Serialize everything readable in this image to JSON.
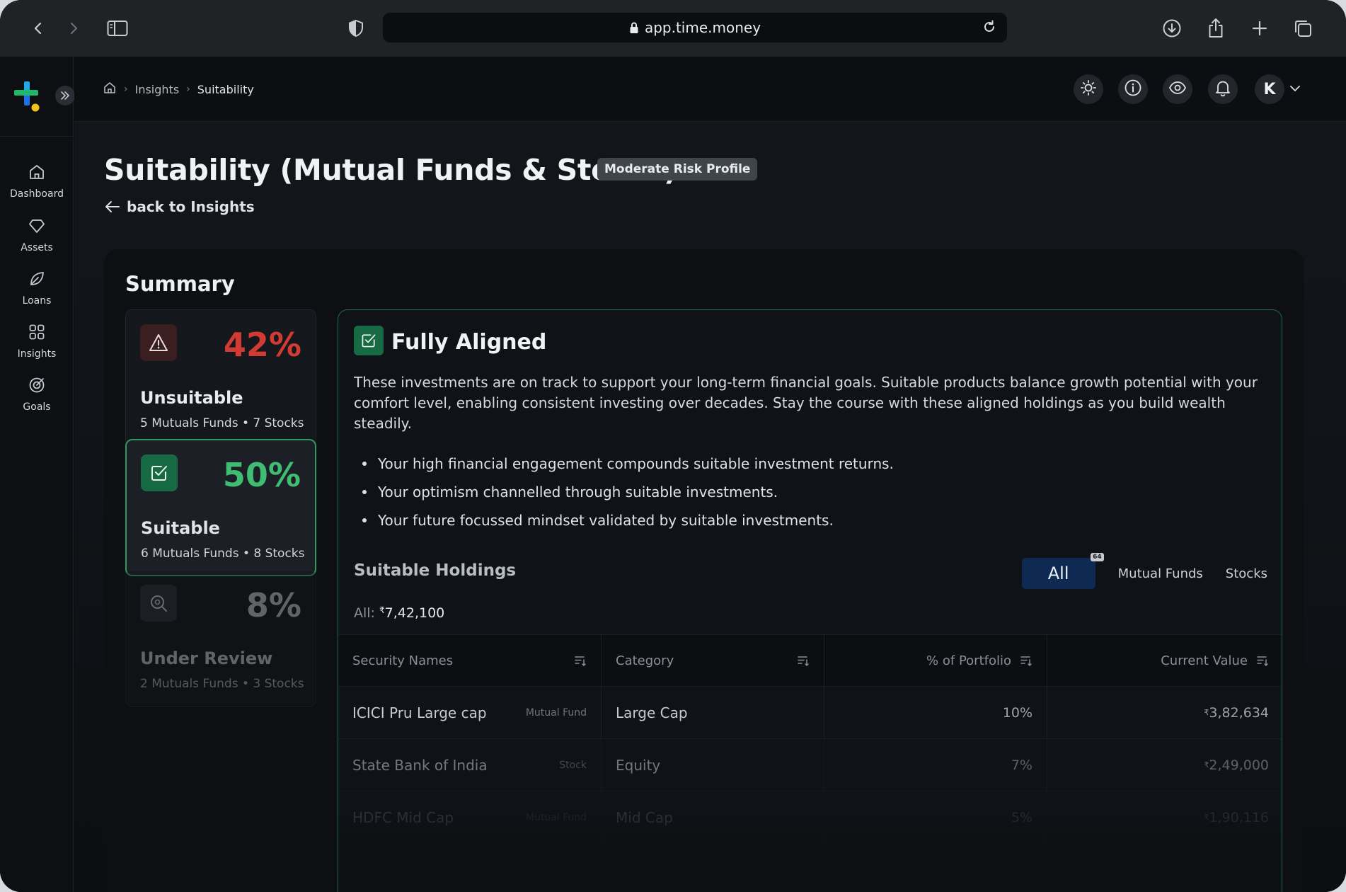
{
  "browser": {
    "url": "app.time.money"
  },
  "sidebar": {
    "items": [
      {
        "label": "Dashboard",
        "icon": "home-icon"
      },
      {
        "label": "Assets",
        "icon": "diamond-icon"
      },
      {
        "label": "Loans",
        "icon": "leaf-icon"
      },
      {
        "label": "Insights",
        "icon": "grid-icon"
      },
      {
        "label": "Goals",
        "icon": "target-icon"
      }
    ]
  },
  "header": {
    "breadcrumb": [
      "Insights",
      "Suitability"
    ],
    "avatar_initial": "K"
  },
  "page": {
    "title": "Suitability (Mutual Funds & Stocks)",
    "risk_badge": "Moderate Risk Profile",
    "back_label": "back to Insights"
  },
  "summary": {
    "title": "Summary",
    "cards": [
      {
        "percent": "42%",
        "name": "Unsuitable",
        "sub": "5 Mutuals Funds • 7 Stocks",
        "color": "#d23a34"
      },
      {
        "percent": "50%",
        "name": "Suitable",
        "sub": "6 Mutuals Funds • 8 Stocks",
        "color": "#3fbd72"
      },
      {
        "percent": "8%",
        "name": "Under Review",
        "sub": "2 Mutuals Funds • 3 Stocks",
        "color": "#c7cacf"
      }
    ]
  },
  "detail": {
    "title": "Fully Aligned",
    "description": "These investments are on track to support your long-term financial goals. Suitable products balance growth potential with your comfort level, enabling consistent investing over decades. Stay the course with these aligned holdings as you build wealth steadily.",
    "bullets": [
      "Your high financial engagement compounds suitable investment returns.",
      "Your optimism channelled through suitable investments.",
      "Your future focussed mindset validated by suitable investments."
    ],
    "holdings_title": "Suitable Holdings",
    "filters": {
      "all": "All",
      "all_count": "64",
      "mutual_funds": "Mutual Funds",
      "stocks": "Stocks"
    },
    "total_label": "All:",
    "total_currency": "₹",
    "total_value": "7,42,100"
  },
  "table": {
    "headers": [
      "Security Names",
      "Category",
      "% of Portfolio",
      "Current Value"
    ],
    "rows": [
      {
        "name": "ICICI Pru Large cap",
        "type": "Mutual Fund",
        "category": "Large Cap",
        "percent": "10%",
        "currency": "₹",
        "value": "3,82,634"
      },
      {
        "name": "State Bank of India",
        "type": "Stock",
        "category": "Equity",
        "percent": "7%",
        "currency": "₹",
        "value": "2,49,000"
      },
      {
        "name": "HDFC Mid Cap",
        "type": "Mutual Fund",
        "category": "Mid Cap",
        "percent": "5%",
        "currency": "₹",
        "value": "1,90,116"
      }
    ]
  },
  "colors": {
    "accent_green": "#3fbd72",
    "danger_red": "#d23a34",
    "active_tab": "#0f2a52"
  }
}
